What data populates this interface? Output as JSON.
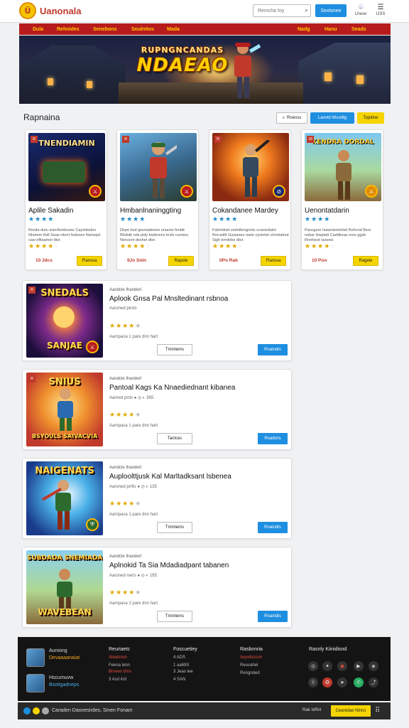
{
  "header": {
    "logo_text": "Uanonala",
    "logo_mark": "Ü",
    "search_placeholder": "Remcha foy",
    "subscribe_label": "Sextsnee",
    "icon1_label": "Lheve",
    "icon2_label": "IJSS",
    "search_icon": "search-icon"
  },
  "nav": {
    "left": [
      "Dula",
      "Rehnides",
      "Senebons",
      "Soulnitos",
      "Mada"
    ],
    "right": [
      "Nadg",
      "Hanu",
      "Seads"
    ]
  },
  "hero": {
    "line1": "RUPNGNCANDAS",
    "line2": "NDAEAO"
  },
  "section": {
    "title": "Rapnaina",
    "btn_search": "Rnenss",
    "btn_mid": "Lanvtd Wureltg",
    "btn_right": "Topdine"
  },
  "cards": [
    {
      "img_text": "TNENDIAMIN",
      "badge": "R",
      "title": "Aplile Sakadin",
      "stars": "★★★★",
      "desc": "Resita dutu xnierfsmbuses Cayshiedon Nhetem thdl Seas rdorrt fedsons Nanwpd caw efltaamet dtor.",
      "rating": "★★★★",
      "price": "10 Jdcs",
      "btn": "Flanssa"
    },
    {
      "img_text": "",
      "badge": "R",
      "title": "Hmbanlnaninggting",
      "stars": "★★★★",
      "desc": "Dirpe bsd gwvnadoeon orsanis fenbtt Rhdsib nds pidy bsderens trcits ruvmeu Nenssnt deshet dtor.",
      "rating": "★★★★",
      "price": "9Jo Snln",
      "btn": "Rapsle"
    },
    {
      "img_text": "",
      "badge": "R",
      "title": "Cokandanee Mardey",
      "stars": "★★★★",
      "desc": "Fobindnet smtnibrngnnts ccanivdatnt Rerustitt Guwaoes raste cyniolsh shrmiahed Sigh brmlebe dtor.",
      "rating": "★★★★",
      "price": "0Po Rab",
      "btn": "Flanssa"
    },
    {
      "img_text": "KENDRA DORDAL",
      "badge": "18",
      "title": "Uenontatdarin",
      "stars": "★★★★",
      "desc": "Pancgore Isawnteetshtel Rehcnd Bsor nobar Hwptatt Caddkeas rens ggsb Rnnfsest taseed.",
      "rating": "★★★★",
      "price": "10 Pon",
      "btn": "Ragele"
    }
  ],
  "list_items": [
    {
      "img_top": "SNEDALS",
      "img_bot": "SANJAE",
      "badge": "R",
      "kicker": "Aandcle Ihanderl",
      "title": "Aplook Gnsa Pal Mnsltedinant rsbnoa",
      "meta": "Aaroned pirsts",
      "stars": "★★★★",
      "sub": "Aarnpaca 1 pare dnn hart",
      "btn1": "Tmmlems",
      "btn2": "Rnaindts"
    },
    {
      "img_top": "SNIUS",
      "img_bot": "BSYOULS SAIVACVIA",
      "badge": "R",
      "kicker": "Aandcle Ihanderl",
      "title": "Pantoal Kags Ka Nnaediednant kibanea",
      "meta": "Aanred prrts  ● ◎ ◐  365",
      "stars": "★★★★",
      "sub": "Aarnpaca 1 pare dnn hart",
      "btn1": "Tanlces",
      "btn2": "Rnailsrts"
    },
    {
      "img_top": "NAIGENATS",
      "img_bot": "",
      "badge": "R",
      "kicker": "Aandcle Ihanderl",
      "title": "Auploolttjusk Kal Marltadksant lsbenea",
      "meta": "Aaroned prrlts  ● ◎ ◐  135",
      "stars": "★★★★",
      "sub": "Aarnpaca 1 pare dnn hart",
      "btn1": "Tmmlems",
      "btn2": "Rnaindts"
    },
    {
      "img_top": "SUBDADA SNEMIADA",
      "img_bot": "WAVEBEAN",
      "badge": "R",
      "kicker": "Aandcle Ihanderl",
      "title": "Aplnokid Ta Sia Mdadiadpant tabanen",
      "meta": "Aaroned nerts  ● ◎ ◐  195",
      "stars": "★★★★",
      "sub": "Aarnpaca 1 pare dnn hart",
      "btn1": "Tmmlems",
      "btn2": "Rnaindts"
    }
  ],
  "footer": {
    "profile1_name": "Auniong",
    "profile1_sub": "Devaaaanaiat",
    "profile2_name": "Hscumuvw",
    "profile2_sub": "Bsoitgadneps",
    "col1_head": "Reuriaetc",
    "col1_items": [
      "Aleatsnsn",
      "Feena lenn",
      "Bnreen bins",
      "3 Asd itrd"
    ],
    "col2_head": "Foscuetiey",
    "col2_items": [
      "4 ADS",
      "1 aa69S",
      "3 Jeao lee",
      "4 SAN"
    ],
    "col3_head": "Rasbnnria",
    "col3_items": [
      "Aeyvtoscon",
      "Reuvahel",
      "Rengnded"
    ],
    "col4_head": "Rasnly Kiinidisnd",
    "social_icons": [
      "instagram-icon",
      "bluesky-icon",
      "reddit-icon",
      "youtube-icon",
      "discord-icon",
      "pinterest-icon",
      "snapchat-icon",
      "whatsapp-icon",
      "telegram-icon"
    ]
  },
  "bottombar": {
    "text": "Caraden  Daonesirdes,  Sinen Fonam",
    "right_text": "Rak IsRnl",
    "btn": "Ceanidae Nlnns"
  },
  "colors": {
    "nav_bg": "#b71c1c",
    "nav_text": "#ffcc00",
    "primary": "#1e8ee0",
    "accent": "#f5d400",
    "price": "#c0392b"
  }
}
